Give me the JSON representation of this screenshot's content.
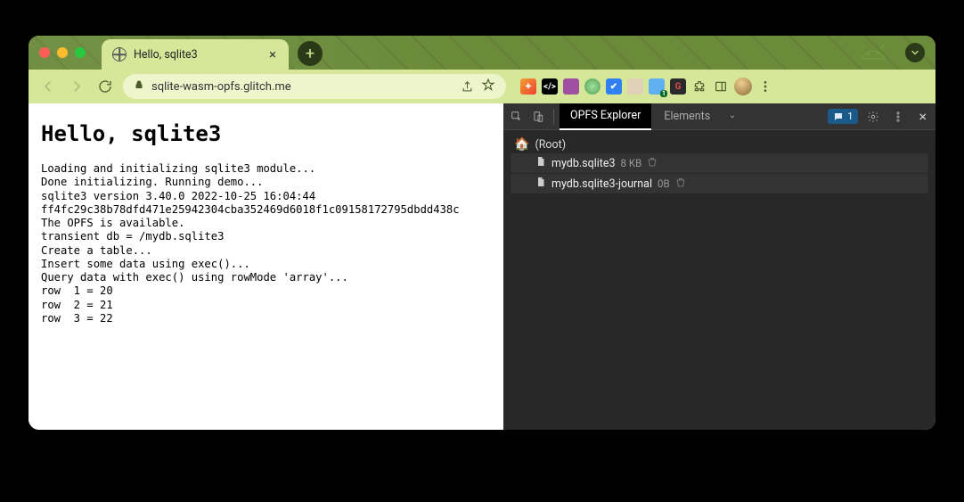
{
  "tab": {
    "title": "Hello, sqlite3"
  },
  "url": "sqlite-wasm-opfs.glitch.me",
  "page": {
    "heading": "Hello, sqlite3",
    "log": "Loading and initializing sqlite3 module...\nDone initializing. Running demo...\nsqlite3 version 3.40.0 2022-10-25 16:04:44\nff4fc29c38b78dfd471e25942304cba352469d6018f1c09158172795dbdd438c\nThe OPFS is available.\ntransient db = /mydb.sqlite3\nCreate a table...\nInsert some data using exec()...\nQuery data with exec() using rowMode 'array'...\nrow  1 = 20\nrow  2 = 21\nrow  3 = 22"
  },
  "devtools": {
    "tabs": {
      "active": "OPFS Explorer",
      "next": "Elements"
    },
    "badge_count": "1",
    "tree": {
      "root_label": "(Root)",
      "files": [
        {
          "name": "mydb.sqlite3",
          "size": "8 KB"
        },
        {
          "name": "mydb.sqlite3-journal",
          "size": "0B"
        }
      ]
    }
  }
}
